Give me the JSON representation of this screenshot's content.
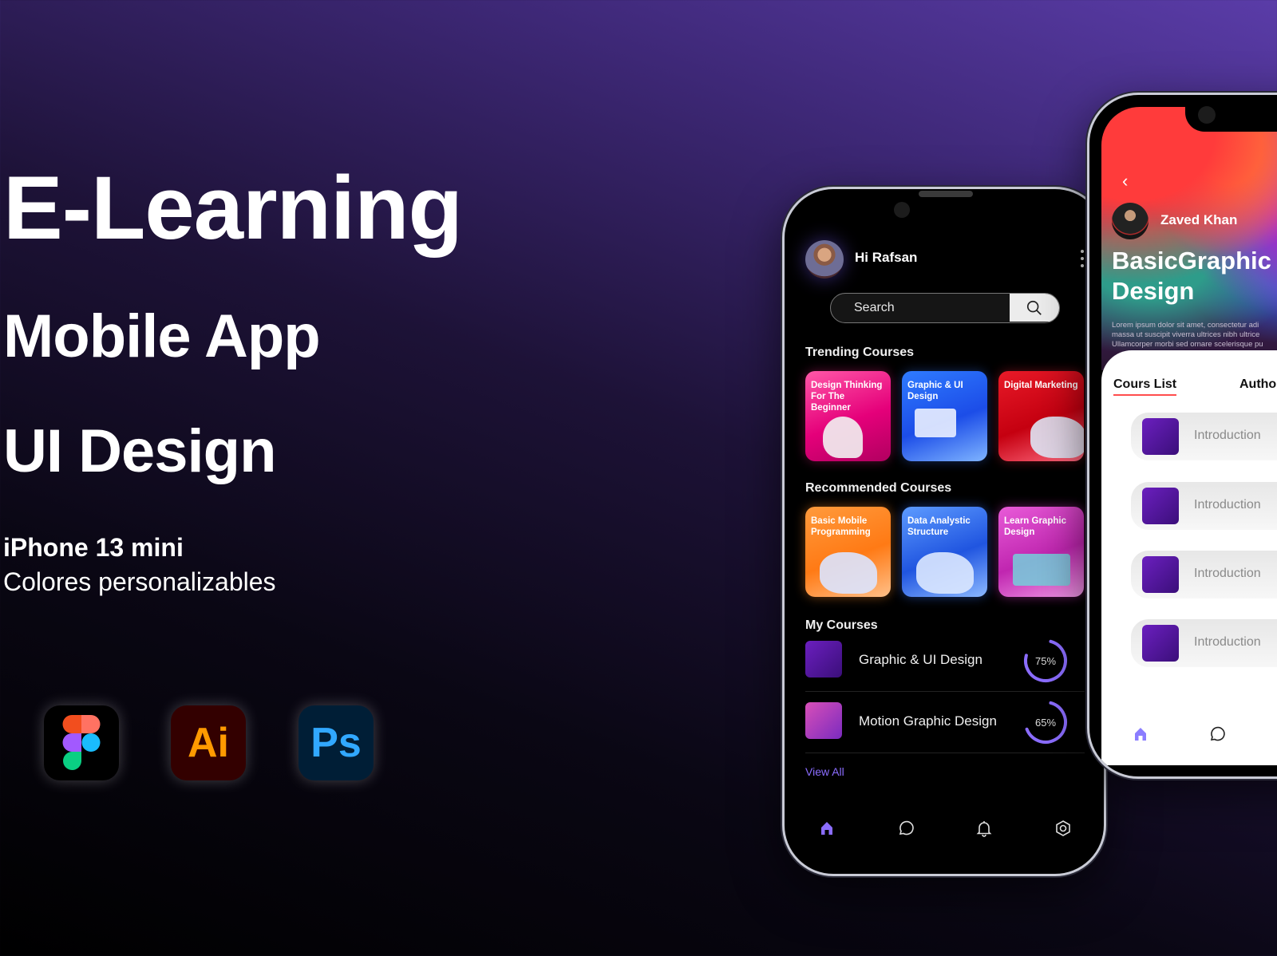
{
  "hero": {
    "title": "E-Learning",
    "subtitle_line1": "Mobile App",
    "subtitle_line2": "UI Design",
    "device": "iPhone 13 mini",
    "note": "Colores personalizables"
  },
  "tools": [
    {
      "name": "Figma",
      "icon": "figma-icon"
    },
    {
      "name": "Illustrator",
      "label": "Ai",
      "icon": "illustrator-icon",
      "bg": "#330000",
      "fg": "#ff9a00"
    },
    {
      "name": "Photoshop",
      "label": "Ps",
      "icon": "photoshop-icon",
      "bg": "#001e36",
      "fg": "#31a8ff"
    }
  ],
  "home_screen": {
    "greeting": "Hi Rafsan",
    "search": {
      "placeholder": "Search"
    },
    "trending_title": "Trending Courses",
    "trending": [
      {
        "title": "Design Thinking For The Beginner"
      },
      {
        "title": "Graphic & UI Design"
      },
      {
        "title": "Digital Marketing"
      }
    ],
    "recommended_title": "Recommended Courses",
    "recommended": [
      {
        "title": "Basic Mobile Programming"
      },
      {
        "title": "Data Analystic Structure"
      },
      {
        "title": "Learn Graphic Design"
      }
    ],
    "my_courses_title": "My Courses",
    "my_courses": [
      {
        "title": "Graphic & UI Design",
        "progress_label": "75%",
        "progress": 75
      },
      {
        "title": "Motion Graphic Design",
        "progress_label": "65%",
        "progress": 65
      }
    ],
    "view_all": "View All",
    "tabbar": [
      "home",
      "chat",
      "notifications",
      "settings"
    ],
    "accent_color": "#8b6dff"
  },
  "detail_screen": {
    "back": "‹",
    "author": "Zaved Khan",
    "title_line1": "BasicGraphic",
    "title_line2": "Design",
    "description": [
      "Lorem ipsum dolor sit amet, consectetur adi",
      "massa ut suscipit viverra ultrices nibh ultrice",
      "Ullamcorper morbi sed ornare scelerisque pu"
    ],
    "tabs": {
      "active": "Cours List",
      "other": "Autho"
    },
    "lessons": [
      {
        "title": "Introduction"
      },
      {
        "title": "Introduction"
      },
      {
        "title": "Introduction"
      },
      {
        "title": "Introduction"
      }
    ],
    "tab_active_underline": "#ff4d4d"
  }
}
